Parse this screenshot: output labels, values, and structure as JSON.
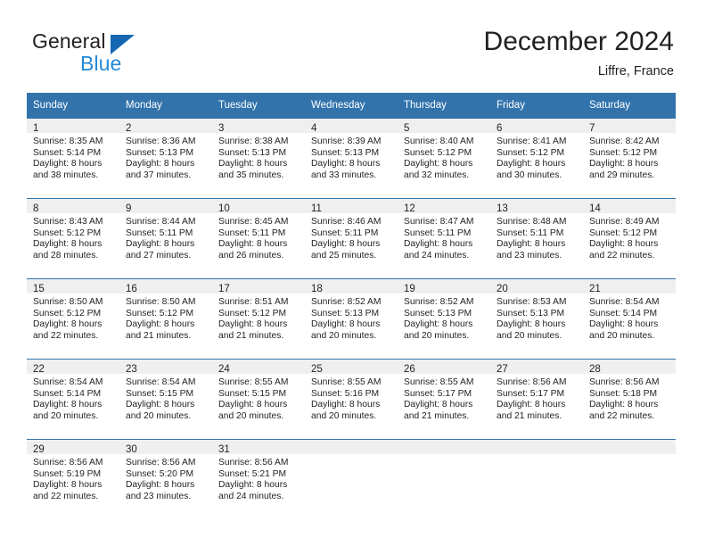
{
  "brand": {
    "name_part1": "General",
    "name_part2": "Blue",
    "logo_icon": "triangle-flag-icon"
  },
  "header": {
    "month_title": "December 2024",
    "location": "Liffre, France"
  },
  "calendar": {
    "weekday_headers": [
      "Sunday",
      "Monday",
      "Tuesday",
      "Wednesday",
      "Thursday",
      "Friday",
      "Saturday"
    ],
    "colors": {
      "header_bg": "#3273ac",
      "cell_header_bg": "#efefef",
      "accent": "#1567b2",
      "brand_blue": "#2389d6",
      "text": "#231f20"
    },
    "weeks": [
      [
        {
          "day": "1",
          "sunrise": "Sunrise: 8:35 AM",
          "sunset": "Sunset: 5:14 PM",
          "daylight_line1": "Daylight: 8 hours",
          "daylight_line2": "and 38 minutes."
        },
        {
          "day": "2",
          "sunrise": "Sunrise: 8:36 AM",
          "sunset": "Sunset: 5:13 PM",
          "daylight_line1": "Daylight: 8 hours",
          "daylight_line2": "and 37 minutes."
        },
        {
          "day": "3",
          "sunrise": "Sunrise: 8:38 AM",
          "sunset": "Sunset: 5:13 PM",
          "daylight_line1": "Daylight: 8 hours",
          "daylight_line2": "and 35 minutes."
        },
        {
          "day": "4",
          "sunrise": "Sunrise: 8:39 AM",
          "sunset": "Sunset: 5:13 PM",
          "daylight_line1": "Daylight: 8 hours",
          "daylight_line2": "and 33 minutes."
        },
        {
          "day": "5",
          "sunrise": "Sunrise: 8:40 AM",
          "sunset": "Sunset: 5:12 PM",
          "daylight_line1": "Daylight: 8 hours",
          "daylight_line2": "and 32 minutes."
        },
        {
          "day": "6",
          "sunrise": "Sunrise: 8:41 AM",
          "sunset": "Sunset: 5:12 PM",
          "daylight_line1": "Daylight: 8 hours",
          "daylight_line2": "and 30 minutes."
        },
        {
          "day": "7",
          "sunrise": "Sunrise: 8:42 AM",
          "sunset": "Sunset: 5:12 PM",
          "daylight_line1": "Daylight: 8 hours",
          "daylight_line2": "and 29 minutes."
        }
      ],
      [
        {
          "day": "8",
          "sunrise": "Sunrise: 8:43 AM",
          "sunset": "Sunset: 5:12 PM",
          "daylight_line1": "Daylight: 8 hours",
          "daylight_line2": "and 28 minutes."
        },
        {
          "day": "9",
          "sunrise": "Sunrise: 8:44 AM",
          "sunset": "Sunset: 5:11 PM",
          "daylight_line1": "Daylight: 8 hours",
          "daylight_line2": "and 27 minutes."
        },
        {
          "day": "10",
          "sunrise": "Sunrise: 8:45 AM",
          "sunset": "Sunset: 5:11 PM",
          "daylight_line1": "Daylight: 8 hours",
          "daylight_line2": "and 26 minutes."
        },
        {
          "day": "11",
          "sunrise": "Sunrise: 8:46 AM",
          "sunset": "Sunset: 5:11 PM",
          "daylight_line1": "Daylight: 8 hours",
          "daylight_line2": "and 25 minutes."
        },
        {
          "day": "12",
          "sunrise": "Sunrise: 8:47 AM",
          "sunset": "Sunset: 5:11 PM",
          "daylight_line1": "Daylight: 8 hours",
          "daylight_line2": "and 24 minutes."
        },
        {
          "day": "13",
          "sunrise": "Sunrise: 8:48 AM",
          "sunset": "Sunset: 5:11 PM",
          "daylight_line1": "Daylight: 8 hours",
          "daylight_line2": "and 23 minutes."
        },
        {
          "day": "14",
          "sunrise": "Sunrise: 8:49 AM",
          "sunset": "Sunset: 5:12 PM",
          "daylight_line1": "Daylight: 8 hours",
          "daylight_line2": "and 22 minutes."
        }
      ],
      [
        {
          "day": "15",
          "sunrise": "Sunrise: 8:50 AM",
          "sunset": "Sunset: 5:12 PM",
          "daylight_line1": "Daylight: 8 hours",
          "daylight_line2": "and 22 minutes."
        },
        {
          "day": "16",
          "sunrise": "Sunrise: 8:50 AM",
          "sunset": "Sunset: 5:12 PM",
          "daylight_line1": "Daylight: 8 hours",
          "daylight_line2": "and 21 minutes."
        },
        {
          "day": "17",
          "sunrise": "Sunrise: 8:51 AM",
          "sunset": "Sunset: 5:12 PM",
          "daylight_line1": "Daylight: 8 hours",
          "daylight_line2": "and 21 minutes."
        },
        {
          "day": "18",
          "sunrise": "Sunrise: 8:52 AM",
          "sunset": "Sunset: 5:13 PM",
          "daylight_line1": "Daylight: 8 hours",
          "daylight_line2": "and 20 minutes."
        },
        {
          "day": "19",
          "sunrise": "Sunrise: 8:52 AM",
          "sunset": "Sunset: 5:13 PM",
          "daylight_line1": "Daylight: 8 hours",
          "daylight_line2": "and 20 minutes."
        },
        {
          "day": "20",
          "sunrise": "Sunrise: 8:53 AM",
          "sunset": "Sunset: 5:13 PM",
          "daylight_line1": "Daylight: 8 hours",
          "daylight_line2": "and 20 minutes."
        },
        {
          "day": "21",
          "sunrise": "Sunrise: 8:54 AM",
          "sunset": "Sunset: 5:14 PM",
          "daylight_line1": "Daylight: 8 hours",
          "daylight_line2": "and 20 minutes."
        }
      ],
      [
        {
          "day": "22",
          "sunrise": "Sunrise: 8:54 AM",
          "sunset": "Sunset: 5:14 PM",
          "daylight_line1": "Daylight: 8 hours",
          "daylight_line2": "and 20 minutes."
        },
        {
          "day": "23",
          "sunrise": "Sunrise: 8:54 AM",
          "sunset": "Sunset: 5:15 PM",
          "daylight_line1": "Daylight: 8 hours",
          "daylight_line2": "and 20 minutes."
        },
        {
          "day": "24",
          "sunrise": "Sunrise: 8:55 AM",
          "sunset": "Sunset: 5:15 PM",
          "daylight_line1": "Daylight: 8 hours",
          "daylight_line2": "and 20 minutes."
        },
        {
          "day": "25",
          "sunrise": "Sunrise: 8:55 AM",
          "sunset": "Sunset: 5:16 PM",
          "daylight_line1": "Daylight: 8 hours",
          "daylight_line2": "and 20 minutes."
        },
        {
          "day": "26",
          "sunrise": "Sunrise: 8:55 AM",
          "sunset": "Sunset: 5:17 PM",
          "daylight_line1": "Daylight: 8 hours",
          "daylight_line2": "and 21 minutes."
        },
        {
          "day": "27",
          "sunrise": "Sunrise: 8:56 AM",
          "sunset": "Sunset: 5:17 PM",
          "daylight_line1": "Daylight: 8 hours",
          "daylight_line2": "and 21 minutes."
        },
        {
          "day": "28",
          "sunrise": "Sunrise: 8:56 AM",
          "sunset": "Sunset: 5:18 PM",
          "daylight_line1": "Daylight: 8 hours",
          "daylight_line2": "and 22 minutes."
        }
      ],
      [
        {
          "day": "29",
          "sunrise": "Sunrise: 8:56 AM",
          "sunset": "Sunset: 5:19 PM",
          "daylight_line1": "Daylight: 8 hours",
          "daylight_line2": "and 22 minutes."
        },
        {
          "day": "30",
          "sunrise": "Sunrise: 8:56 AM",
          "sunset": "Sunset: 5:20 PM",
          "daylight_line1": "Daylight: 8 hours",
          "daylight_line2": "and 23 minutes."
        },
        {
          "day": "31",
          "sunrise": "Sunrise: 8:56 AM",
          "sunset": "Sunset: 5:21 PM",
          "daylight_line1": "Daylight: 8 hours",
          "daylight_line2": "and 24 minutes."
        },
        {
          "day": "",
          "sunrise": "",
          "sunset": "",
          "daylight_line1": "",
          "daylight_line2": ""
        },
        {
          "day": "",
          "sunrise": "",
          "sunset": "",
          "daylight_line1": "",
          "daylight_line2": ""
        },
        {
          "day": "",
          "sunrise": "",
          "sunset": "",
          "daylight_line1": "",
          "daylight_line2": ""
        },
        {
          "day": "",
          "sunrise": "",
          "sunset": "",
          "daylight_line1": "",
          "daylight_line2": ""
        }
      ]
    ]
  }
}
